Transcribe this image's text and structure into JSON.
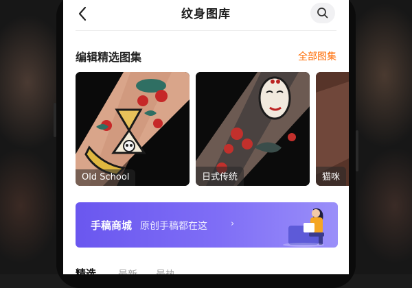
{
  "header": {
    "title": "纹身图库",
    "back_icon": "chevron-left-icon",
    "search_icon": "search-icon"
  },
  "section": {
    "title": "编辑精选图集",
    "link": "全部图集"
  },
  "collections": [
    {
      "label": "Old School"
    },
    {
      "label": "日式传统"
    },
    {
      "label": "猫咪"
    }
  ],
  "banner": {
    "title": "手稿商城",
    "subtitle": "原创手稿都在这",
    "chevron": "›"
  },
  "tabs": [
    {
      "label": "精选",
      "active": true
    },
    {
      "label": "最新",
      "active": false
    },
    {
      "label": "最热",
      "active": false
    }
  ],
  "colors": {
    "accent": "#ff6a00",
    "banner_start": "#6a57ef",
    "banner_end": "#9a8ff9"
  }
}
